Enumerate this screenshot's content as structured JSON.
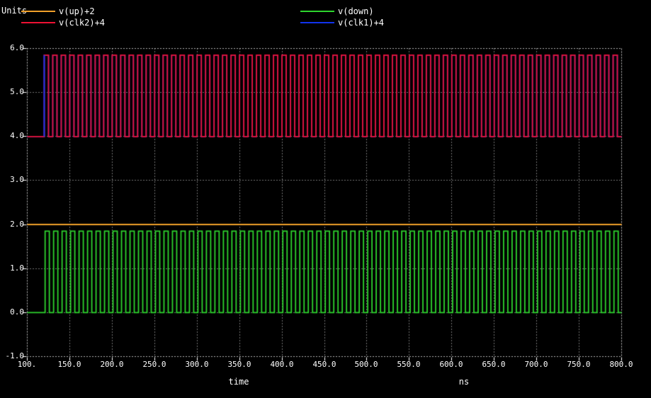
{
  "chart_data": {
    "type": "line",
    "title": "",
    "xlabel": "time",
    "x_unit": "ns",
    "ylabel": "Units",
    "xlim": [
      100,
      800
    ],
    "ylim": [
      -1,
      6
    ],
    "grid": "dotted",
    "background": "#000000",
    "grid_color": "#ffffff",
    "x_tick_values": [
      100,
      150,
      200,
      250,
      300,
      350,
      400,
      450,
      500,
      550,
      600,
      650,
      700,
      750,
      800
    ],
    "x_ticks": [
      "100.",
      "150.0",
      "200.0",
      "250.0",
      "300.0",
      "350.0",
      "400.0",
      "450.0",
      "500.0",
      "550.0",
      "600.0",
      "650.0",
      "700.0",
      "750.0",
      "800.0"
    ],
    "y_tick_values": [
      6,
      5,
      4,
      3,
      2,
      1,
      0,
      -1
    ],
    "y_ticks": [
      "6.0",
      "5.0",
      "4.0",
      "3.0",
      "2.0",
      "1.0",
      "0.0",
      "-1.0"
    ],
    "legend": [
      {
        "label": "v(up)+2",
        "color": "#f0a02a",
        "waveform": "constant",
        "value": 2.0,
        "t_start": 100,
        "t_end": 800
      },
      {
        "label": "v(clk2)+4",
        "color": "#ee1133",
        "waveform": "square",
        "low": 4.0,
        "high": 5.85,
        "t_first_rise": 120,
        "period": 10,
        "pulse_width": 5,
        "t_end": 800
      },
      {
        "label": "v(down)",
        "color": "#2ed52e",
        "waveform": "square",
        "low": 0.0,
        "high": 1.85,
        "t_first_rise": 121,
        "period": 10,
        "pulse_width": 5,
        "t_end": 800
      },
      {
        "label": "v(clk1)+4",
        "color": "#1133ee",
        "waveform": "square",
        "low": 4.0,
        "high": 5.85,
        "t_first_rise": 120,
        "period": 10,
        "pulse_width": 5,
        "t_end": 800
      }
    ]
  }
}
